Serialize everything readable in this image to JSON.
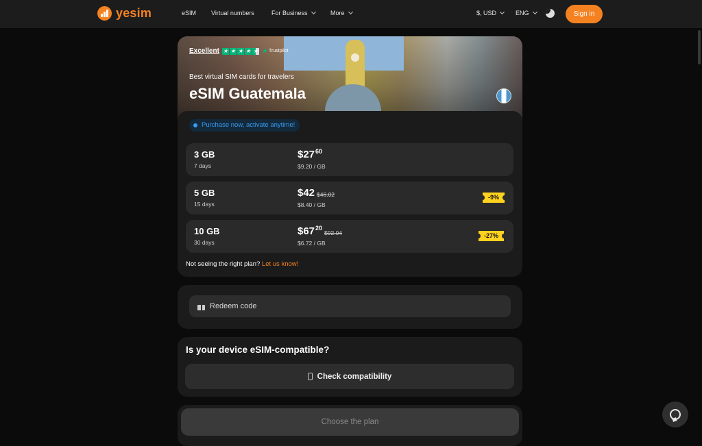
{
  "header": {
    "brand": "yesim",
    "nav": [
      {
        "label": "eSIM",
        "dropdown": false
      },
      {
        "label": "Virtual numbers",
        "dropdown": false
      },
      {
        "label": "For Business",
        "dropdown": true
      },
      {
        "label": "More",
        "dropdown": true
      }
    ],
    "currency": "$, USD",
    "language": "ENG",
    "sign_in": "Sign in",
    "accent_color": "#f58220"
  },
  "hero": {
    "rating_label": "Excellent",
    "rating_stars": 4.5,
    "rating_brand": "Trustpilot",
    "subtitle": "Best virtual SIM cards for travelers",
    "title": "eSIM Guatemala"
  },
  "plans_panel": {
    "notice": "Purchase now, activate anytime!",
    "plans": [
      {
        "data": "3 GB",
        "days": "7 days",
        "price_main": "$27",
        "price_cents": "60",
        "old_price": "",
        "per_gb": "$9.20 / GB",
        "discount": ""
      },
      {
        "data": "5 GB",
        "days": "15 days",
        "price_main": "$42",
        "price_cents": "",
        "old_price": "$46.02",
        "per_gb": "$8.40 / GB",
        "discount": "-9%"
      },
      {
        "data": "10 GB",
        "days": "30 days",
        "price_main": "$67",
        "price_cents": "20",
        "old_price": "$92.04",
        "per_gb": "$6.72 / GB",
        "discount": "-27%"
      }
    ],
    "not_seeing": "Not seeing the right plan?",
    "let_us_know": "Let us know!"
  },
  "redeem": {
    "label": "Redeem code"
  },
  "compat": {
    "title": "Is your device eSIM-compatible?",
    "button": "Check compatibility"
  },
  "choose": {
    "button": "Choose the plan"
  }
}
